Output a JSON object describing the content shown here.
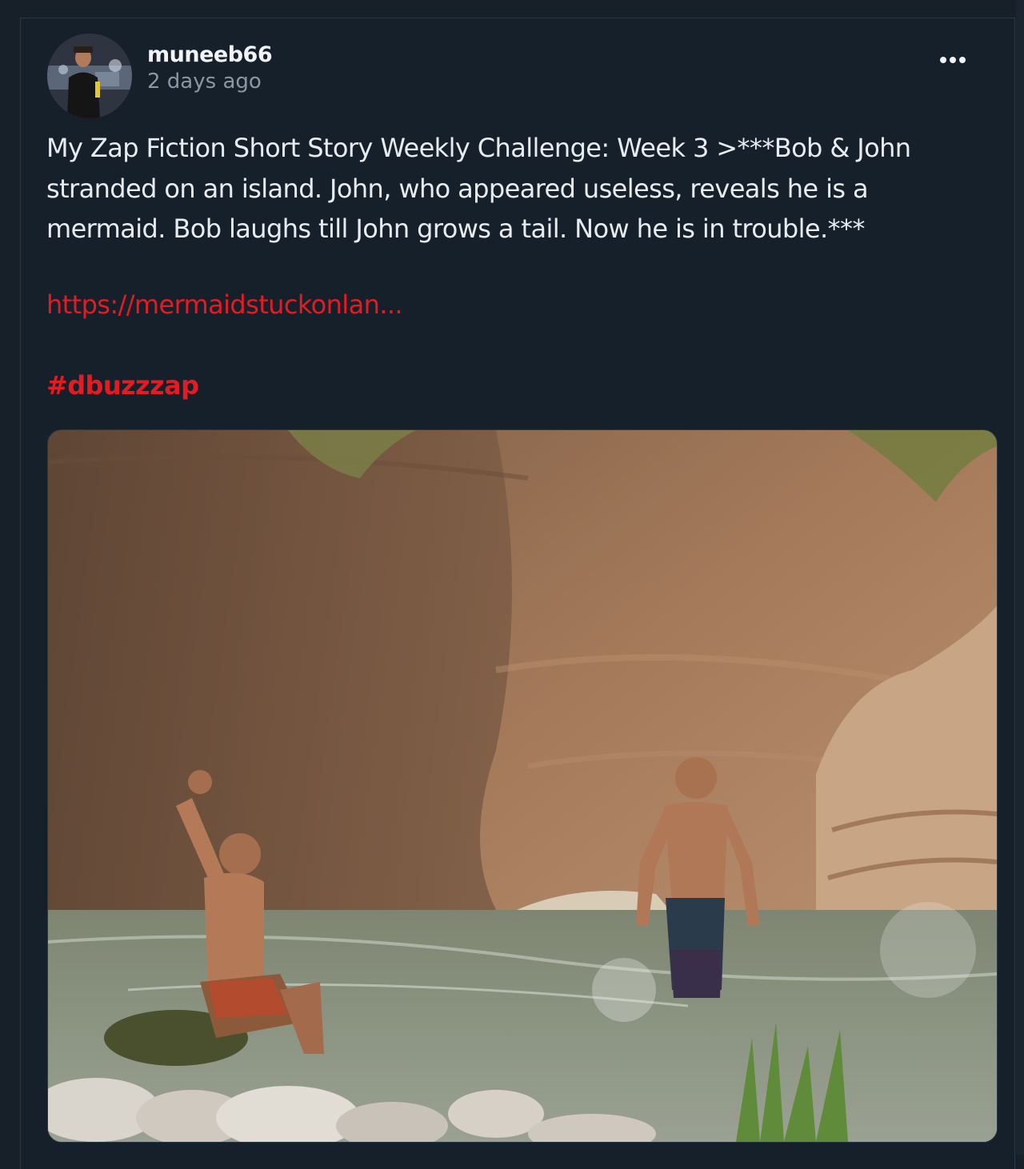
{
  "post": {
    "author": {
      "username": "muneeb66",
      "timestamp": "2 days ago",
      "avatar_icon": "user-avatar"
    },
    "more_icon": "ellipsis-icon",
    "body": "My Zap Fiction Short Story Weekly Challenge: Week 3 >***Bob & John stranded on an island. John, who appeared useless, reveals he is a mermaid. Bob laughs till John grows a tail. Now he is in trouble.***",
    "link_text": "https://mermaidstuckonlan...",
    "hashtag": "#dbuzzzap",
    "image": {
      "subject": "photo-two-men-river-canyon"
    }
  },
  "colors": {
    "background": "#16202b",
    "accent_red": "#e31b23",
    "text_primary": "#e8ecf1",
    "text_muted": "#8c96a3"
  }
}
